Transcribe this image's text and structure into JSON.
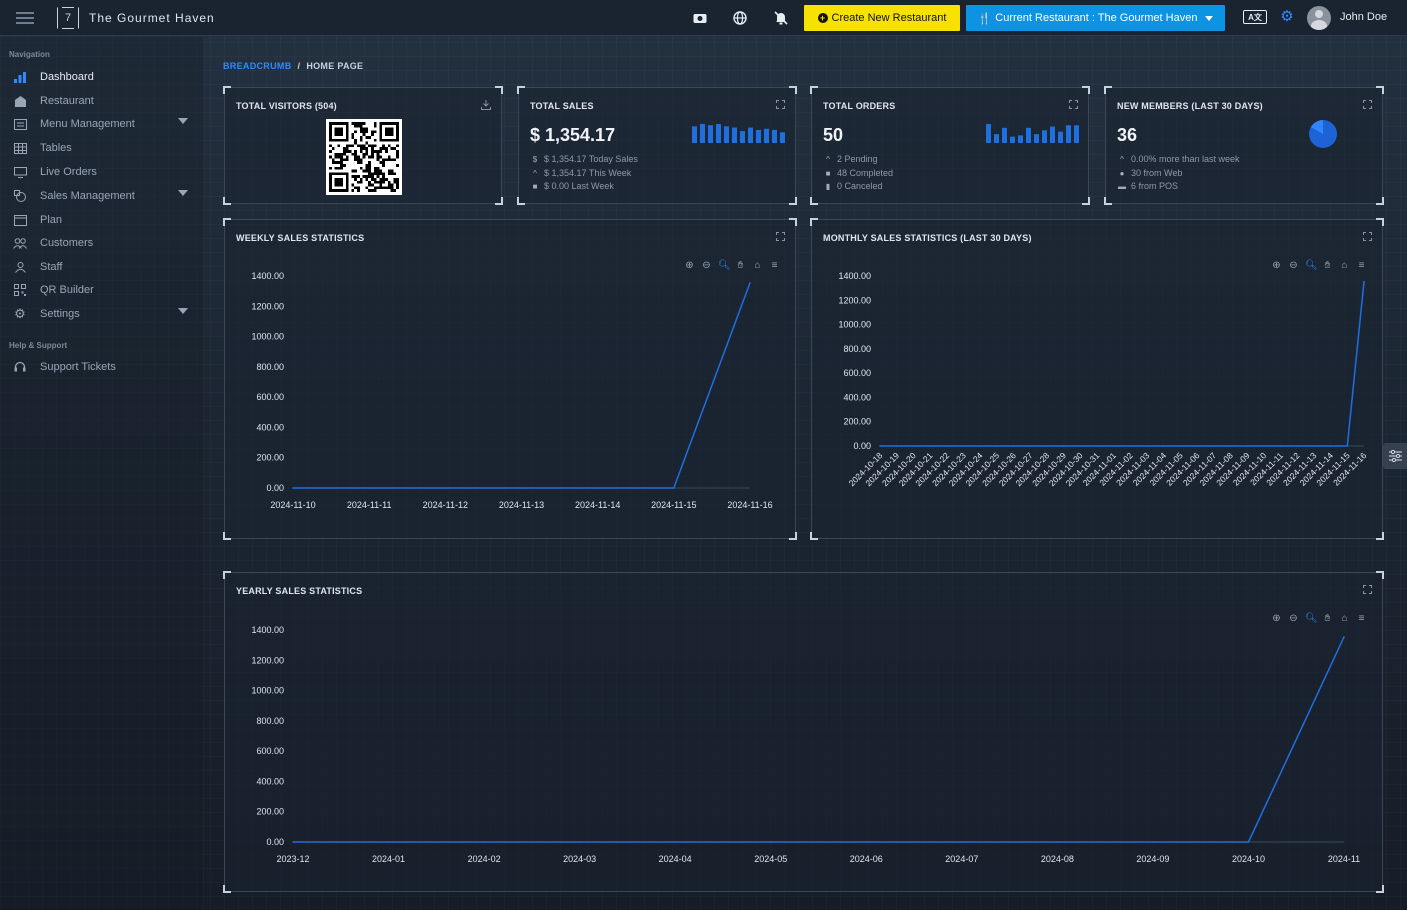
{
  "app": {
    "title": "The Gourmet Haven"
  },
  "topbar": {
    "create_label": "Create New Restaurant",
    "current_label": "Current Restaurant : The Gourmet Haven",
    "lang_label": "A文",
    "user_name": "John Doe"
  },
  "sidebar": {
    "nav_heading": "Navigation",
    "support_heading": "Help & Support",
    "items": [
      {
        "label": "Dashboard"
      },
      {
        "label": "Restaurant"
      },
      {
        "label": "Menu Management"
      },
      {
        "label": "Tables"
      },
      {
        "label": "Live Orders"
      },
      {
        "label": "Sales Management"
      },
      {
        "label": "Plan"
      },
      {
        "label": "Customers"
      },
      {
        "label": "Staff"
      },
      {
        "label": "QR Builder"
      },
      {
        "label": "Settings"
      },
      {
        "label": "Support Tickets"
      }
    ]
  },
  "breadcrumb": {
    "root": "BREADCRUMB",
    "sep": "/",
    "current": "HOME PAGE"
  },
  "cards": {
    "visitors": {
      "title": "TOTAL VISITORS (504)"
    },
    "sales": {
      "title": "TOTAL SALES",
      "value": "$ 1,354.17",
      "lines": [
        "$ 1,354.17 Today Sales",
        "$ 1,354.17 This Week",
        "$ 0.00 Last Week"
      ]
    },
    "orders": {
      "title": "TOTAL ORDERS",
      "value": "50",
      "lines": [
        "2 Pending",
        "48 Completed",
        "0 Canceled"
      ]
    },
    "members": {
      "title": "NEW MEMBERS (LAST 30 DAYS)",
      "value": "36",
      "lines": [
        "0.00% more than last week",
        "30 from Web",
        "6 from POS"
      ]
    }
  },
  "colors": {
    "accent": "#2d8cff",
    "line": "#1f6fe0",
    "yellow": "#f7e100",
    "current": "#0d93e4"
  },
  "chart_data": [
    {
      "type": "line",
      "title": "WEEKLY SALES STATISTICS",
      "x": [
        "2024-11-10",
        "2024-11-11",
        "2024-11-12",
        "2024-11-13",
        "2024-11-14",
        "2024-11-15",
        "2024-11-16"
      ],
      "series": [
        {
          "values": [
            0,
            0,
            0,
            0,
            0,
            0,
            1354.17
          ]
        }
      ],
      "yticks": [
        "0.00",
        "200.00",
        "400.00",
        "600.00",
        "800.00",
        "1000.00",
        "1200.00",
        "1400.00"
      ],
      "ylim": [
        0,
        1400
      ]
    },
    {
      "type": "line",
      "title": "MONTHLY SALES STATISTICS (LAST 30 DAYS)",
      "x": [
        "2024-10-18",
        "2024-10-19",
        "2024-10-20",
        "2024-10-21",
        "2024-10-22",
        "2024-10-23",
        "2024-10-24",
        "2024-10-25",
        "2024-10-26",
        "2024-10-27",
        "2024-10-28",
        "2024-10-29",
        "2024-10-30",
        "2024-10-31",
        "2024-11-01",
        "2024-11-02",
        "2024-11-03",
        "2024-11-04",
        "2024-11-05",
        "2024-11-06",
        "2024-11-07",
        "2024-11-08",
        "2024-11-09",
        "2024-11-10",
        "2024-11-11",
        "2024-11-12",
        "2024-11-13",
        "2024-11-14",
        "2024-11-15",
        "2024-11-16"
      ],
      "series": [
        {
          "values": [
            0,
            0,
            0,
            0,
            0,
            0,
            0,
            0,
            0,
            0,
            0,
            0,
            0,
            0,
            0,
            0,
            0,
            0,
            0,
            0,
            0,
            0,
            0,
            0,
            0,
            0,
            0,
            0,
            0,
            1354.17
          ]
        }
      ],
      "yticks": [
        "0.00",
        "200.00",
        "400.00",
        "600.00",
        "800.00",
        "1000.00",
        "1200.00",
        "1400.00"
      ],
      "ylim": [
        0,
        1400
      ]
    },
    {
      "type": "line",
      "title": "YEARLY SALES STATISTICS",
      "x": [
        "2023-12",
        "2024-01",
        "2024-02",
        "2024-03",
        "2024-04",
        "2024-05",
        "2024-06",
        "2024-07",
        "2024-08",
        "2024-09",
        "2024-10",
        "2024-11"
      ],
      "series": [
        {
          "values": [
            0,
            0,
            0,
            0,
            0,
            0,
            0,
            0,
            0,
            0,
            0,
            1354.17
          ]
        }
      ],
      "yticks": [
        "0.00",
        "200.00",
        "400.00",
        "600.00",
        "800.00",
        "1000.00",
        "1200.00",
        "1400.00"
      ],
      "ylim": [
        0,
        1400
      ]
    }
  ],
  "sparklines": {
    "sales": [
      14,
      16,
      15,
      16,
      14,
      13,
      10,
      13,
      11,
      12,
      11,
      9
    ],
    "orders": [
      15,
      7,
      12,
      5,
      6,
      12,
      7,
      10,
      13,
      9,
      14,
      14
    ]
  },
  "members_pie": {
    "major": 30,
    "minor": 6
  }
}
